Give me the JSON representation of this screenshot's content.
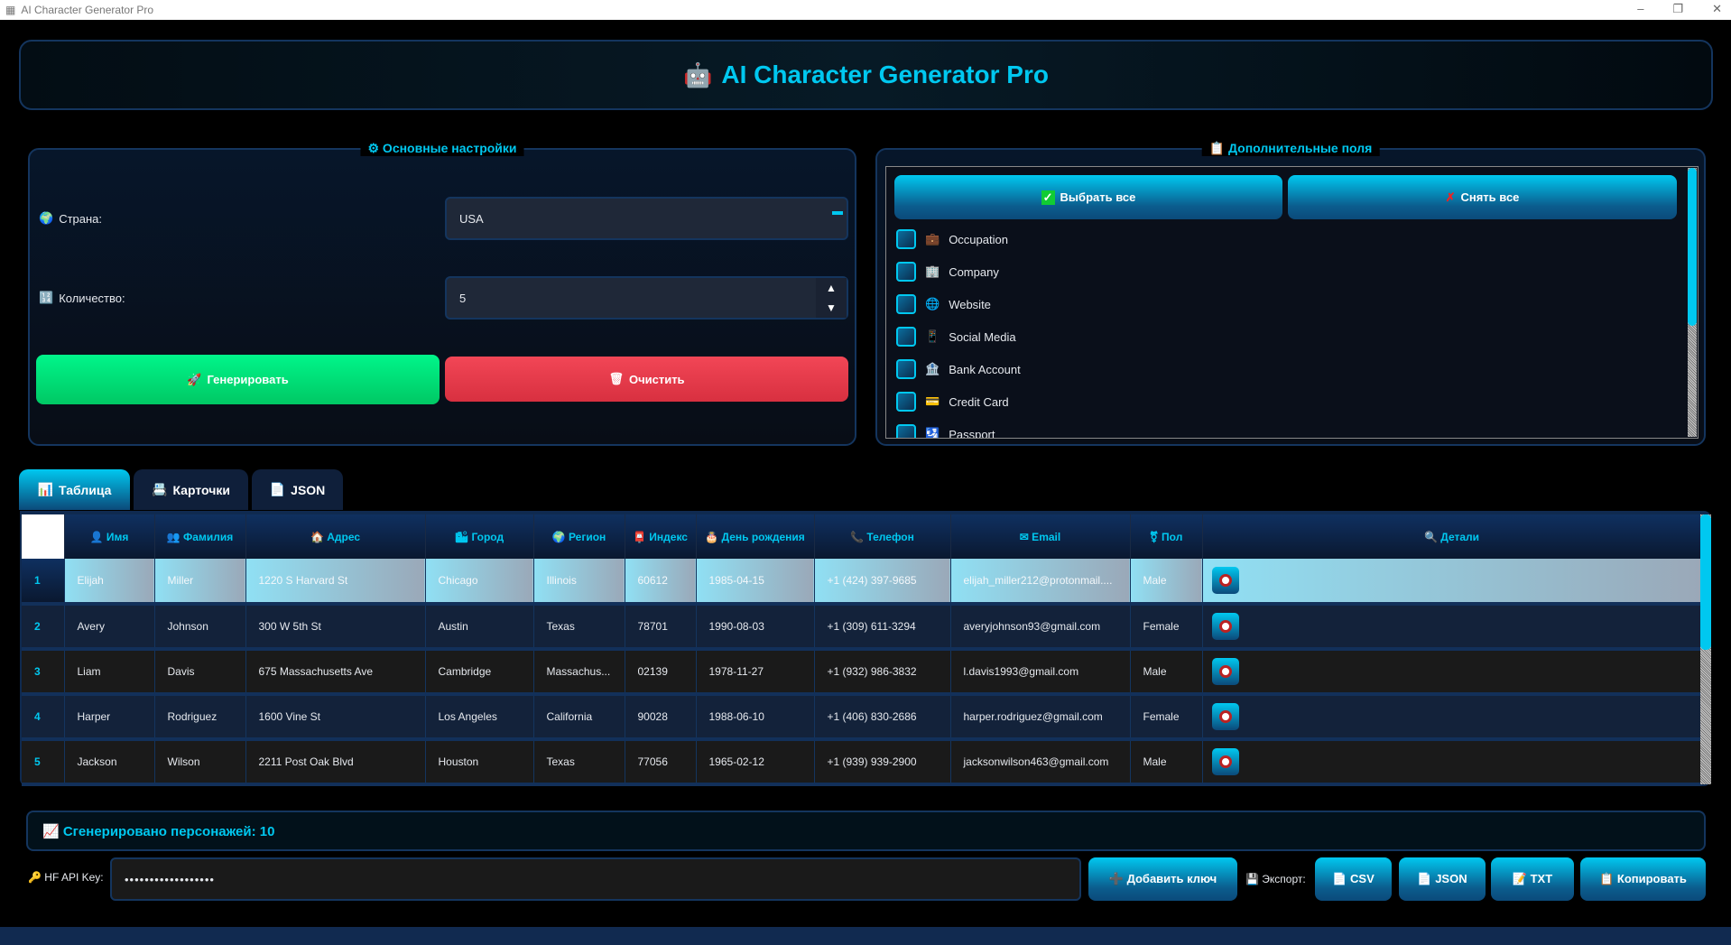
{
  "window": {
    "title": "AI Character Generator Pro",
    "minimize": "–",
    "maximize": "❐",
    "close": "✕"
  },
  "header": {
    "icon": "🤖",
    "title": "AI Character Generator Pro"
  },
  "settings": {
    "title": "⚙ Основные настройки",
    "country_label": "Страна:",
    "country_value": "USA",
    "count_label": "Количество:",
    "count_value": "5",
    "generate": "Генерировать",
    "clear": "Очистить"
  },
  "fields": {
    "title": "📋 Дополнительные поля",
    "select_all": "Выбрать все",
    "deselect_all": "Снять все",
    "items": [
      {
        "icon": "💼",
        "label": "Occupation"
      },
      {
        "icon": "🏢",
        "label": "Company"
      },
      {
        "icon": "🌐",
        "label": "Website"
      },
      {
        "icon": "📱",
        "label": "Social Media"
      },
      {
        "icon": "🏦",
        "label": "Bank Account"
      },
      {
        "icon": "💳",
        "label": "Credit Card"
      },
      {
        "icon": "🛂",
        "label": "Passport"
      }
    ]
  },
  "tabs": [
    {
      "label": "Таблица",
      "icon": "📊"
    },
    {
      "label": "Карточки",
      "icon": "📇"
    },
    {
      "label": "JSON",
      "icon": "📄"
    }
  ],
  "table": {
    "columns": [
      "👤 Имя",
      "👥 Фамилия",
      "🏠 Адрес",
      "🏙 Город",
      "🌍 Регион",
      "📮 Индекс",
      "🎂 День рождения",
      "📞 Телефон",
      "✉ Email",
      "⚧ Пол",
      "🔍 Детали"
    ],
    "rows": [
      [
        "1",
        "Elijah",
        "Miller",
        "1220 S Harvard St",
        "Chicago",
        "Illinois",
        "60612",
        "1985-04-15",
        "+1 (424) 397-9685",
        "elijah_miller212@protonmail....",
        "Male"
      ],
      [
        "2",
        "Avery",
        "Johnson",
        "300 W 5th St",
        "Austin",
        "Texas",
        "78701",
        "1990-08-03",
        "+1 (309) 611-3294",
        "averyjohnson93@gmail.com",
        "Female"
      ],
      [
        "3",
        "Liam",
        "Davis",
        "675 Massachusetts Ave",
        "Cambridge",
        "Massachus...",
        "02139",
        "1978-11-27",
        "+1 (932) 986-3832",
        "l.davis1993@gmail.com",
        "Male"
      ],
      [
        "4",
        "Harper",
        "Rodriguez",
        "1600 Vine St",
        "Los Angeles",
        "California",
        "90028",
        "1988-06-10",
        "+1 (406) 830-2686",
        "harper.rodriguez@gmail.com",
        "Female"
      ],
      [
        "5",
        "Jackson",
        "Wilson",
        "2211 Post Oak Blvd",
        "Houston",
        "Texas",
        "77056",
        "1965-02-12",
        "+1 (939) 939-2900",
        "jacksonwilson463@gmail.com",
        "Male"
      ]
    ]
  },
  "status": {
    "text": "📈 Сгенерировано персонажей: 10"
  },
  "api": {
    "label": "🔑 HF API Key:",
    "value": "••••••••••••••••••",
    "add_key": "➕ Добавить ключ",
    "export_label": "💾 Экспорт:",
    "csv": "📄 CSV",
    "json": "📄 JSON",
    "txt": "📝 TXT",
    "copy": "📋 Копировать"
  },
  "colors": {
    "accent": "#00c8f0",
    "generate": "#00e07a",
    "clear": "#e83a4a",
    "panel": "#07162a"
  }
}
